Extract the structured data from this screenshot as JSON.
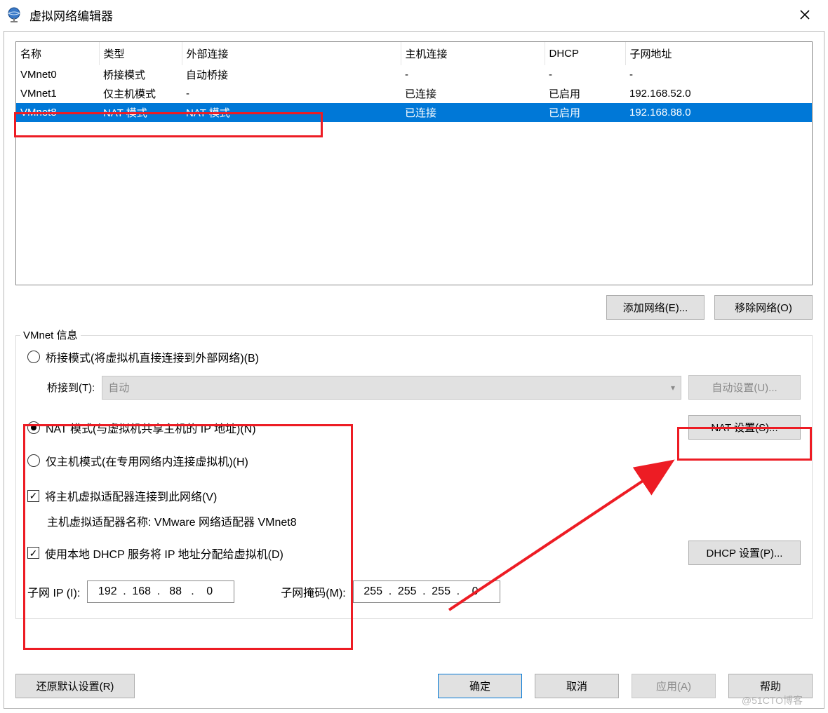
{
  "window": {
    "title": "虚拟网络编辑器"
  },
  "table": {
    "headers": {
      "name": "名称",
      "type": "类型",
      "external": "外部连接",
      "host": "主机连接",
      "dhcp": "DHCP",
      "subnet": "子网地址"
    },
    "rows": [
      {
        "name": "VMnet0",
        "type": "桥接模式",
        "external": "自动桥接",
        "host": "-",
        "dhcp": "-",
        "subnet": "-"
      },
      {
        "name": "VMnet1",
        "type": "仅主机模式",
        "external": "-",
        "host": "已连接",
        "dhcp": "已启用",
        "subnet": "192.168.52.0"
      },
      {
        "name": "VMnet8",
        "type": "NAT 模式",
        "external": "NAT 模式",
        "host": "已连接",
        "dhcp": "已启用",
        "subnet": "192.168.88.0"
      }
    ],
    "selected_index": 2
  },
  "buttons": {
    "add_network": "添加网络(E)...",
    "remove_network": "移除网络(O)",
    "auto_settings": "自动设置(U)...",
    "nat_settings": "NAT 设置(S)...",
    "dhcp_settings": "DHCP 设置(P)...",
    "restore": "还原默认设置(R)",
    "ok": "确定",
    "cancel": "取消",
    "apply": "应用(A)",
    "help": "帮助"
  },
  "info": {
    "legend": "VMnet 信息",
    "bridged_label": "桥接模式(将虚拟机直接连接到外部网络)(B)",
    "bridged_to_label": "桥接到(T):",
    "bridged_to_value": "自动",
    "nat_label": "NAT 模式(与虚拟机共享主机的 IP 地址)(N)",
    "hostonly_label": "仅主机模式(在专用网络内连接虚拟机)(H)",
    "connect_host_label": "将主机虚拟适配器连接到此网络(V)",
    "adapter_name_label": "主机虚拟适配器名称: VMware 网络适配器 VMnet8",
    "use_dhcp_label": "使用本地 DHCP 服务将 IP 地址分配给虚拟机(D)",
    "subnet_ip_label": "子网 IP (I):",
    "subnet_ip": {
      "o1": "192",
      "o2": "168",
      "o3": "88",
      "o4": "0"
    },
    "subnet_mask_label": "子网掩码(M):",
    "subnet_mask": {
      "o1": "255",
      "o2": "255",
      "o3": "255",
      "o4": "0"
    }
  },
  "watermark": "@51CTO博客"
}
